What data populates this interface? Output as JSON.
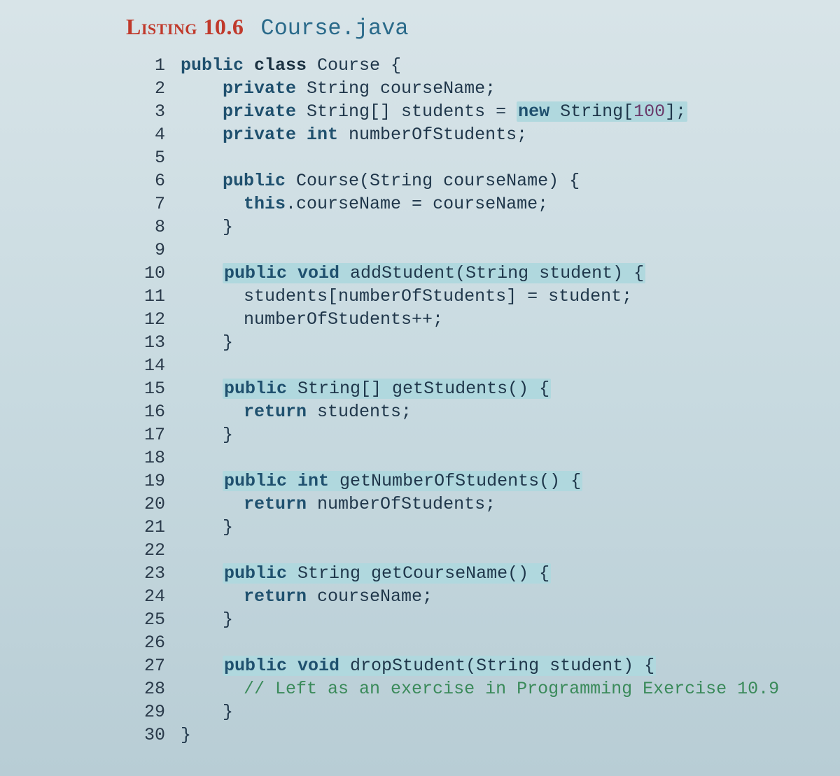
{
  "listing": {
    "label": "Listing 10.6",
    "filename": "Course.java"
  },
  "code": {
    "l1a": "public",
    "l1b": " class",
    "l1c": " Course {",
    "l2a": "    private",
    "l2b": " String courseName;",
    "l3a": "    private",
    "l3b": " String[] students = ",
    "l3c": "new",
    "l3d": " String[",
    "l3e": "100",
    "l3f": "];",
    "l4a": "    private",
    "l4b": " int",
    "l4c": " numberOfStudents;",
    "l5": "",
    "l6a": "    public",
    "l6b": " Course(String courseName) {",
    "l7a": "      this",
    "l7b": ".courseName = courseName;",
    "l8": "    }",
    "l9": "",
    "l10a": "    ",
    "l10b": "public",
    "l10c": " void",
    "l10d": " addStudent(String student) {",
    "l11": "      students[numberOfStudents] = student;",
    "l12": "      numberOfStudents++;",
    "l13": "    }",
    "l14": "",
    "l15a": "    ",
    "l15b": "public",
    "l15c": " String[] getStudents() {",
    "l16a": "      return",
    "l16b": " students;",
    "l17": "    }",
    "l18": "",
    "l19a": "    ",
    "l19b": "public",
    "l19c": " int",
    "l19d": " getNumberOfStudents() {",
    "l20a": "      return",
    "l20b": " numberOfStudents;",
    "l21": "    }",
    "l22": "",
    "l23a": "    ",
    "l23b": "public",
    "l23c": " String getCourseName() {",
    "l24a": "      return",
    "l24b": " courseName;",
    "l25": "    }",
    "l26": "",
    "l27a": "    ",
    "l27b": "public",
    "l27c": " void",
    "l27d": " dropStudent(String student) {",
    "l28a": "      ",
    "l28b": "// Left as an exercise in Programming Exercise 10.9",
    "l29": "    }",
    "l30": "}"
  },
  "lineNumbers": [
    "1",
    "2",
    "3",
    "4",
    "5",
    "6",
    "7",
    "8",
    "9",
    "10",
    "11",
    "12",
    "13",
    "14",
    "15",
    "16",
    "17",
    "18",
    "19",
    "20",
    "21",
    "22",
    "23",
    "24",
    "25",
    "26",
    "27",
    "28",
    "29",
    "30"
  ]
}
